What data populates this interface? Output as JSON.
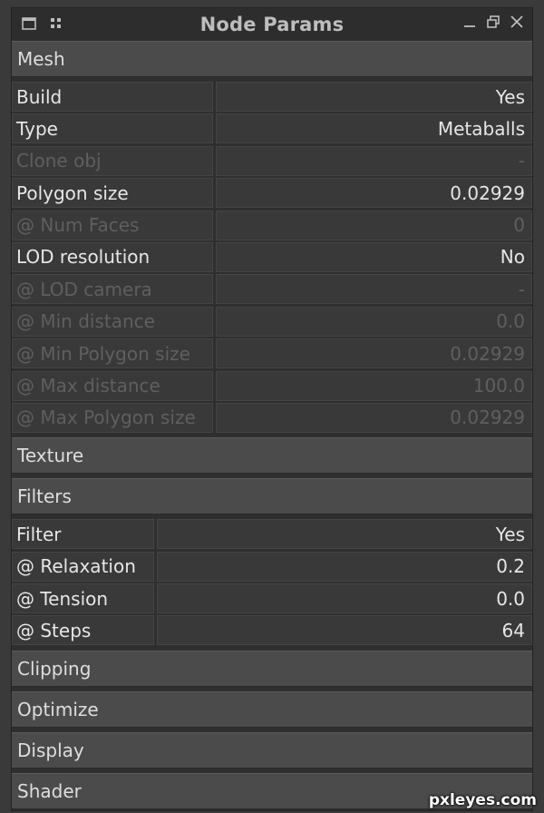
{
  "window": {
    "title": "Node Params"
  },
  "sections": {
    "mesh": "Mesh",
    "texture": "Texture",
    "filters": "Filters",
    "clipping": "Clipping",
    "optimize": "Optimize",
    "display": "Display",
    "shader": "Shader"
  },
  "mesh_rows": [
    {
      "label": "Build",
      "value": "Yes",
      "enabled": true
    },
    {
      "label": "Type",
      "value": "Metaballs",
      "enabled": true
    },
    {
      "label": "Clone obj",
      "value": "-",
      "enabled": false
    },
    {
      "label": "Polygon size",
      "value": "0.02929",
      "enabled": true
    },
    {
      "label": "@ Num Faces",
      "value": "0",
      "enabled": false
    },
    {
      "label": "LOD resolution",
      "value": "No",
      "enabled": true
    },
    {
      "label": "@ LOD camera",
      "value": "-",
      "enabled": false
    },
    {
      "label": "@ Min distance",
      "value": "0.0",
      "enabled": false
    },
    {
      "label": "@ Min Polygon size",
      "value": "0.02929",
      "enabled": false
    },
    {
      "label": "@ Max distance",
      "value": "100.0",
      "enabled": false
    },
    {
      "label": "@ Max Polygon size",
      "value": "0.02929",
      "enabled": false
    }
  ],
  "filter_rows": [
    {
      "label": "Filter",
      "value": "Yes",
      "enabled": true
    },
    {
      "label": "@ Relaxation",
      "value": "0.2",
      "enabled": true
    },
    {
      "label": "@ Tension",
      "value": "0.0",
      "enabled": true
    },
    {
      "label": "@ Steps",
      "value": "64",
      "enabled": true
    }
  ],
  "icons": {
    "left": [
      "window-icon",
      "grid-icon"
    ],
    "right": [
      "minimize-icon",
      "restore-icon",
      "close-icon"
    ]
  },
  "watermark": "pxleyes.com"
}
